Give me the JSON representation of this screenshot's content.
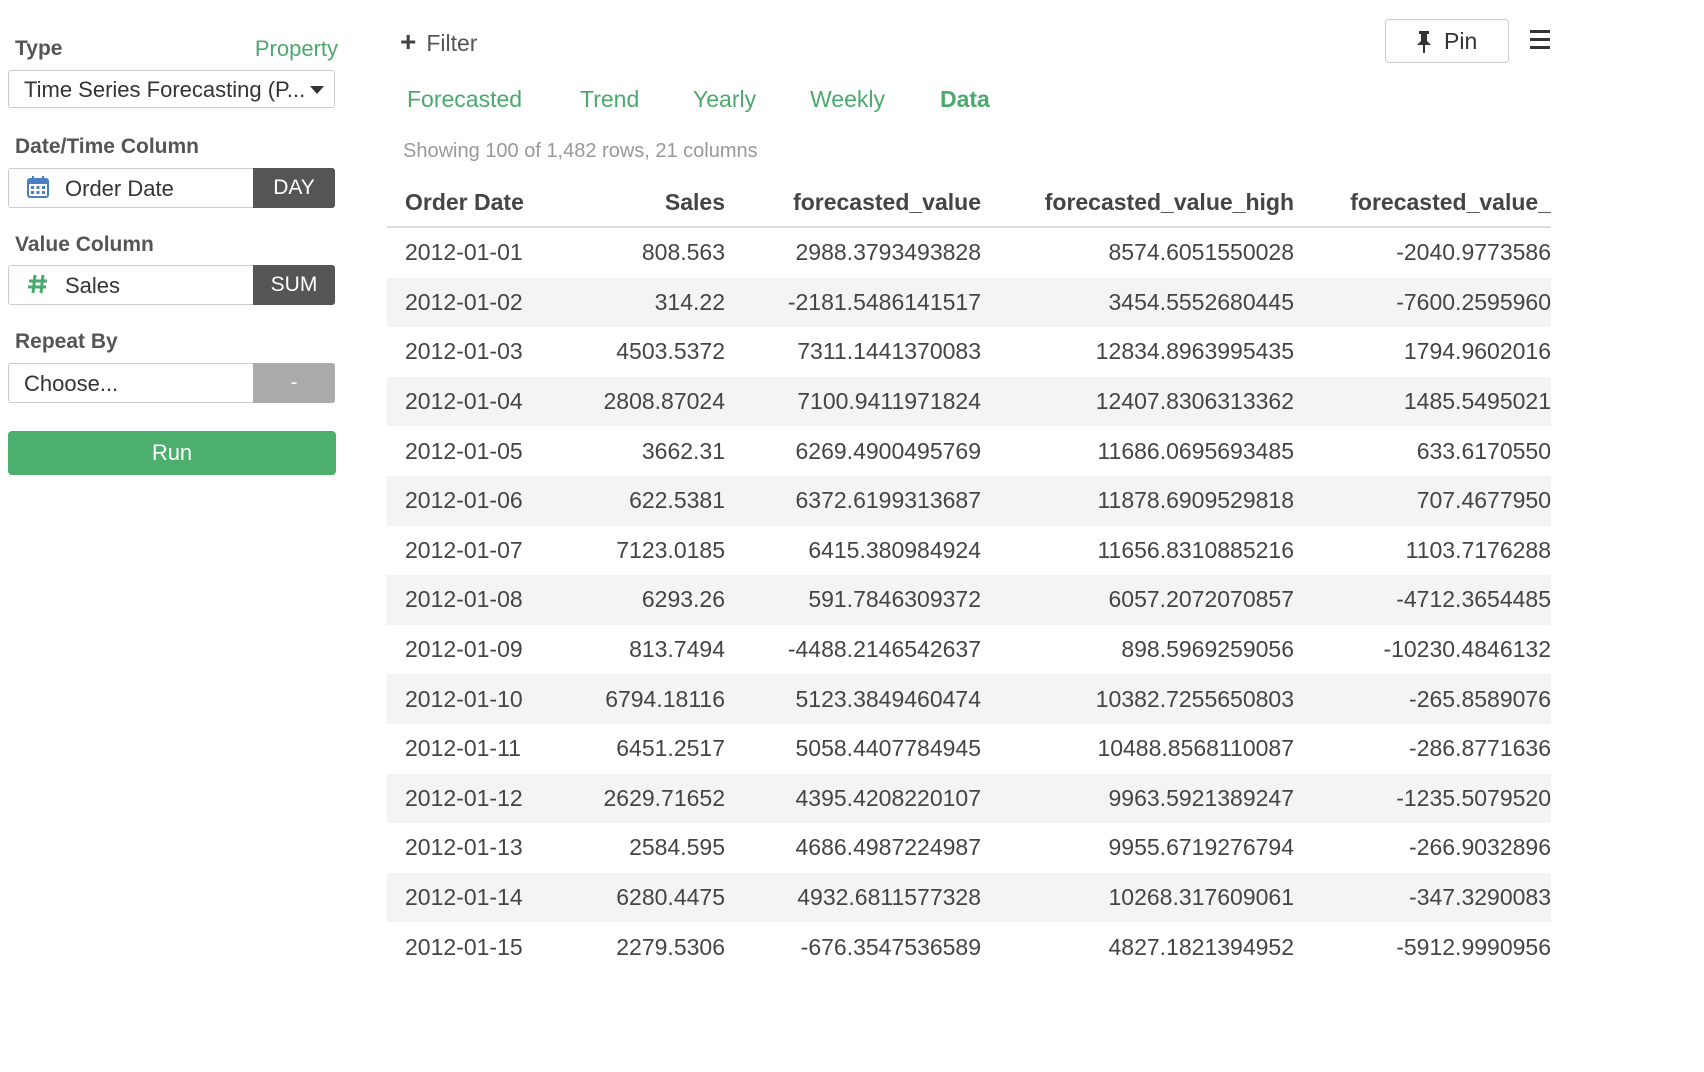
{
  "left_panel": {
    "type_label": "Type",
    "property_link": "Property",
    "type_value": "Time Series Forecasting (P...",
    "date_col_label": "Date/Time Column",
    "date_col_value": "Order Date",
    "date_col_unit": "DAY",
    "value_col_label": "Value Column",
    "value_col_value": "Sales",
    "value_col_agg": "SUM",
    "repeat_label": "Repeat By",
    "repeat_value": "Choose...",
    "repeat_tag": "-",
    "run_label": "Run"
  },
  "toolbar": {
    "filter_label": "Filter",
    "pin_label": "Pin"
  },
  "tabs": [
    {
      "label": "Forecasted"
    },
    {
      "label": "Trend"
    },
    {
      "label": "Yearly"
    },
    {
      "label": "Weekly"
    },
    {
      "label": "Data"
    }
  ],
  "active_tab": "Data",
  "summary": "Showing 100 of 1,482 rows, 21 columns",
  "table": {
    "headers": [
      "Order Date",
      "Sales",
      "forecasted_value",
      "forecasted_value_high",
      "forecasted_value_"
    ],
    "rows": [
      [
        "2012-01-01",
        "808.563",
        "2988.3793493828",
        "8574.6051550028",
        "-2040.9773586"
      ],
      [
        "2012-01-02",
        "314.22",
        "-2181.5486141517",
        "3454.5552680445",
        "-7600.2595960"
      ],
      [
        "2012-01-03",
        "4503.5372",
        "7311.1441370083",
        "12834.8963995435",
        "1794.9602016"
      ],
      [
        "2012-01-04",
        "2808.87024",
        "7100.9411971824",
        "12407.8306313362",
        "1485.5495021"
      ],
      [
        "2012-01-05",
        "3662.31",
        "6269.4900495769",
        "11686.0695693485",
        "633.6170550"
      ],
      [
        "2012-01-06",
        "622.5381",
        "6372.6199313687",
        "11878.6909529818",
        "707.4677950"
      ],
      [
        "2012-01-07",
        "7123.0185",
        "6415.380984924",
        "11656.8310885216",
        "1103.7176288"
      ],
      [
        "2012-01-08",
        "6293.26",
        "591.7846309372",
        "6057.2072070857",
        "-4712.3654485"
      ],
      [
        "2012-01-09",
        "813.7494",
        "-4488.2146542637",
        "898.5969259056",
        "-10230.4846132"
      ],
      [
        "2012-01-10",
        "6794.18116",
        "5123.3849460474",
        "10382.7255650803",
        "-265.8589076"
      ],
      [
        "2012-01-11",
        "6451.2517",
        "5058.4407784945",
        "10488.8568110087",
        "-286.8771636"
      ],
      [
        "2012-01-12",
        "2629.71652",
        "4395.4208220107",
        "9963.5921389247",
        "-1235.5079520"
      ],
      [
        "2012-01-13",
        "2584.595",
        "4686.4987224987",
        "9955.6719276794",
        "-266.9032896"
      ],
      [
        "2012-01-14",
        "6280.4475",
        "4932.6811577328",
        "10268.317609061",
        "-347.3290083"
      ],
      [
        "2012-01-15",
        "2279.5306",
        "-676.3547536589",
        "4827.1821394952",
        "-5912.9990956"
      ]
    ]
  },
  "colors": {
    "accent": "#4aa96c",
    "run_button": "#4caf6e",
    "tag_dark": "#555555",
    "tag_light": "#aaaaaa"
  },
  "icons": [
    "calendar-icon",
    "hash-icon",
    "plus-icon",
    "pin-icon",
    "hamburger-menu-icon",
    "dropdown-caret-icon"
  ]
}
